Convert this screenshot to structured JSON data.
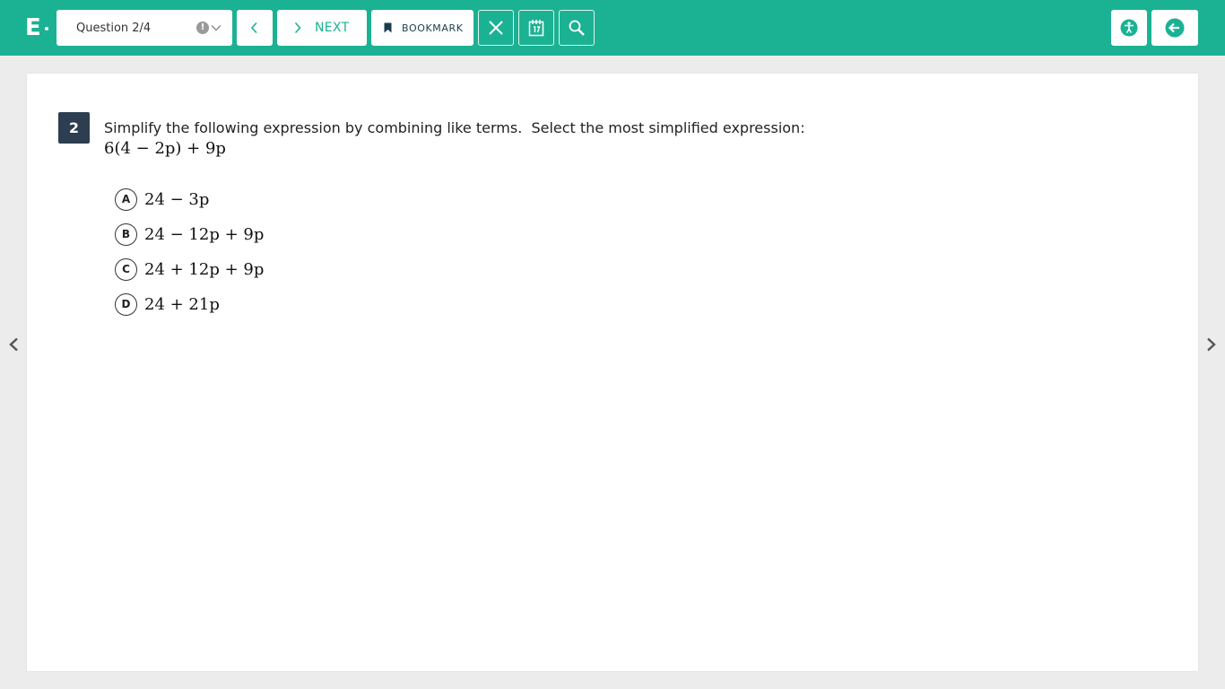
{
  "header": {
    "logo_text": "E",
    "question_selector": "Question 2/4",
    "warning_glyph": "!",
    "next_label": "NEXT",
    "bookmark_label": "BOOKMARK",
    "icons": [
      "chevron-left-icon",
      "chevron-right-icon",
      "bookmark-icon",
      "close-icon",
      "calendar-icon",
      "magnifier-icon",
      "accessibility-icon",
      "exit-icon"
    ]
  },
  "question": {
    "number": "2",
    "prompt": "Simplify the following expression by combining like terms.  Select the most simplified expression:",
    "expression": "6(4 − 2p) + 9p",
    "choices": [
      {
        "letter": "A",
        "text": "24 − 3p"
      },
      {
        "letter": "B",
        "text": "24 − 12p + 9p"
      },
      {
        "letter": "C",
        "text": "24 + 12p + 9p"
      },
      {
        "letter": "D",
        "text": "24 + 21p"
      }
    ]
  },
  "colors": {
    "header_bg": "#1bb293",
    "question_badge_bg": "#2c3e4f",
    "page_bg": "#ececec"
  }
}
